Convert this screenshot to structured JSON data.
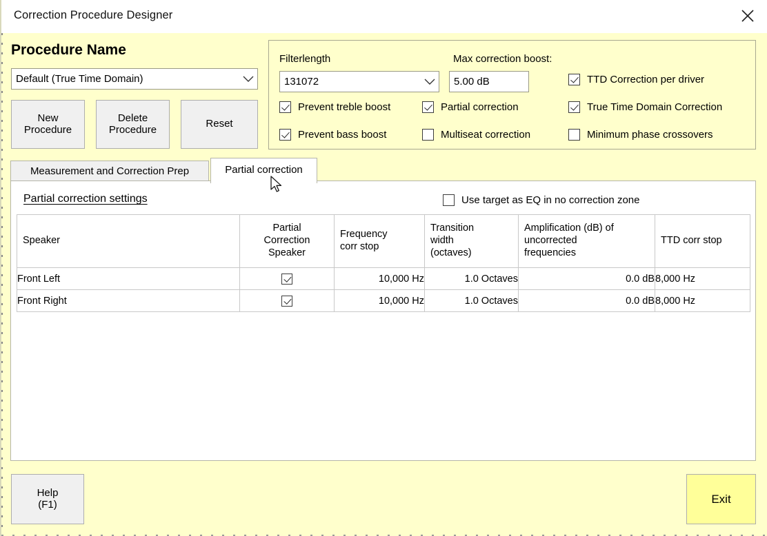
{
  "window": {
    "title": "Correction Procedure Designer",
    "close_icon": "close-icon",
    "background_color": "#FFFFCC",
    "titlebar_color": "#FFFFFF"
  },
  "procedure": {
    "heading": "Procedure Name",
    "selected": "Default (True Time Domain)",
    "dropdown_icon": "chevron-down-icon",
    "buttons": {
      "new": "New\nProcedure",
      "delete": "Delete\nProcedure",
      "reset": "Reset"
    }
  },
  "settings": {
    "filterlength_label": "Filterlength",
    "filterlength_value": "131072",
    "maxboost_label": "Max correction boost:",
    "maxboost_value": "5.00 dB",
    "checkboxes": [
      {
        "name": "prevent-treble-boost",
        "label": "Prevent treble boost",
        "checked": true
      },
      {
        "name": "prevent-bass-boost",
        "label": "Prevent bass boost",
        "checked": true
      },
      {
        "name": "partial-correction",
        "label": "Partial correction",
        "checked": true
      },
      {
        "name": "multiseat-correction",
        "label": "Multiseat correction",
        "checked": false
      },
      {
        "name": "ttd-correction-per-driver",
        "label": "TTD Correction per driver",
        "checked": true
      },
      {
        "name": "true-time-domain-correction",
        "label": "True Time Domain Correction",
        "checked": true
      },
      {
        "name": "minimum-phase-crossovers",
        "label": "Minimum phase crossovers",
        "checked": false
      }
    ]
  },
  "tabs": [
    {
      "label": "Measurement and Correction Prep",
      "active": false
    },
    {
      "label": "Partial correction",
      "active": true
    }
  ],
  "panel": {
    "heading": "Partial correction settings",
    "use_target_label": "Use target as EQ in no correction zone",
    "use_target_checked": false
  },
  "grid": {
    "columns": [
      "Speaker",
      "Partial\nCorrection\nSpeaker",
      "Frequency\ncorr stop",
      "Transition\nwidth\n(octaves)",
      "Amplification (dB)  of\nuncorrected\nfrequencies",
      "TTD corr stop"
    ],
    "rows": [
      {
        "speaker": "Front Left",
        "partial_correction_speaker": true,
        "frequency_corr_stop": "10,000 Hz",
        "transition_width": "1.0 Octaves",
        "amplification": "0.0 dB",
        "ttd_corr_stop": "8,000 Hz",
        "selected": true
      },
      {
        "speaker": "Front Right",
        "partial_correction_speaker": true,
        "frequency_corr_stop": "10,000 Hz",
        "transition_width": "1.0 Octaves",
        "amplification": "0.0 dB",
        "ttd_corr_stop": "8,000 Hz",
        "selected": false
      }
    ],
    "selection_color": "#2F7BD0"
  },
  "footer": {
    "help_label": "Help\n(F1)",
    "exit_label": "Exit",
    "exit_color": "#FFFF99"
  }
}
